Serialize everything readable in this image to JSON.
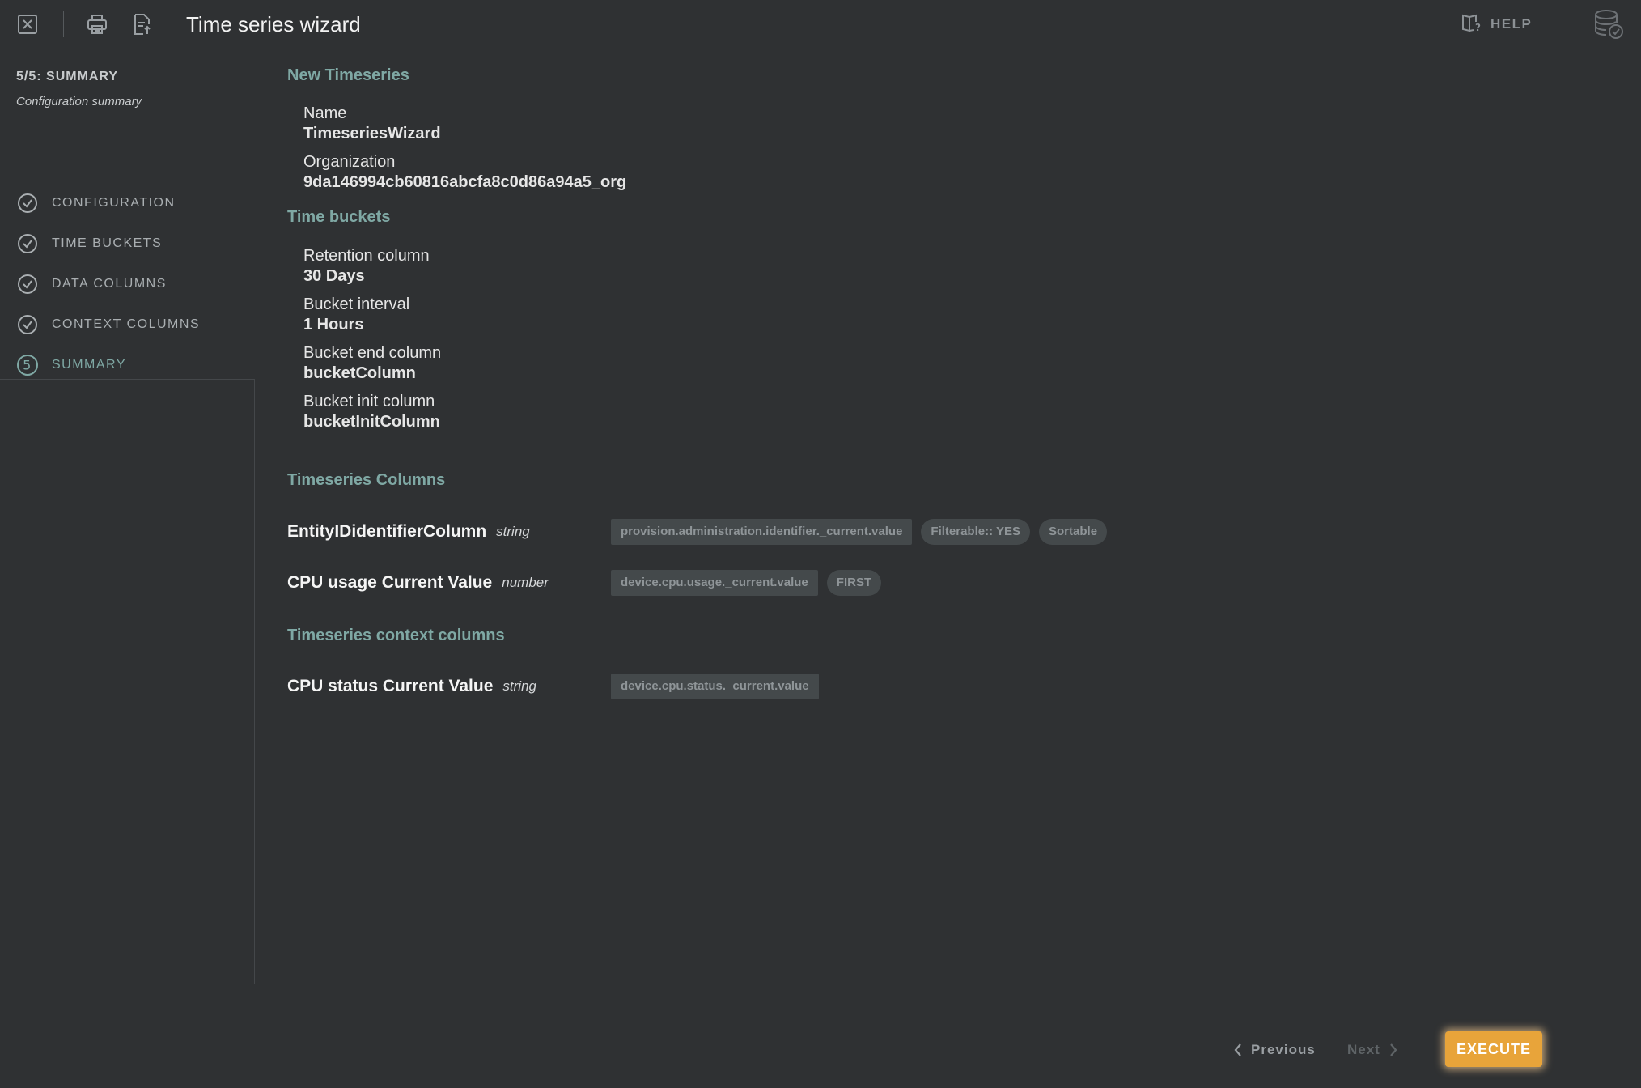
{
  "header": {
    "title": "Time series wizard",
    "help_label": "HELP"
  },
  "sidebar": {
    "step_title": "5/5: SUMMARY",
    "step_subtitle": "Configuration summary",
    "steps": [
      {
        "label": "CONFIGURATION",
        "status": "done"
      },
      {
        "label": "TIME BUCKETS",
        "status": "done"
      },
      {
        "label": "DATA COLUMNS",
        "status": "done"
      },
      {
        "label": "CONTEXT COLUMNS",
        "status": "done"
      },
      {
        "label": "SUMMARY",
        "status": "current",
        "number": "5"
      }
    ]
  },
  "summary": {
    "new_timeseries": {
      "heading": "New Timeseries",
      "name_label": "Name",
      "name_value": "TimeseriesWizard",
      "org_label": "Organization",
      "org_value": "9da146994cb60816abcfa8c0d86a94a5_org"
    },
    "time_buckets": {
      "heading": "Time buckets",
      "retention_label": "Retention column",
      "retention_value": "30 Days",
      "interval_label": "Bucket interval",
      "interval_value": "1 Hours",
      "end_label": "Bucket end column",
      "end_value": "bucketColumn",
      "init_label": "Bucket init column",
      "init_value": "bucketInitColumn"
    },
    "timeseries_columns": {
      "heading": "Timeseries Columns",
      "columns": [
        {
          "name": "EntityIDidentifierColumn",
          "type": "string",
          "tags": [
            "provision.administration.identifier._current.value",
            "Filterable:: YES",
            "Sortable"
          ]
        },
        {
          "name": "CPU usage Current Value",
          "type": "number",
          "tags": [
            "device.cpu.usage._current.value",
            "FIRST"
          ]
        }
      ]
    },
    "context_columns": {
      "heading": "Timeseries context columns",
      "columns": [
        {
          "name": "CPU status Current Value",
          "type": "string",
          "tags": [
            "device.cpu.status._current.value"
          ]
        }
      ]
    }
  },
  "footer": {
    "previous_label": "Previous",
    "next_label": "Next",
    "execute_label": "EXECUTE"
  },
  "colors": {
    "accent": "#7fa8a4",
    "execute": "#e8a43a",
    "background": "#2f3133"
  },
  "icons": {
    "close": "close-icon",
    "print": "print-icon",
    "export": "export-document-icon",
    "help": "help-book-icon",
    "database": "database-check-icon",
    "step_done": "check-circle-icon"
  }
}
